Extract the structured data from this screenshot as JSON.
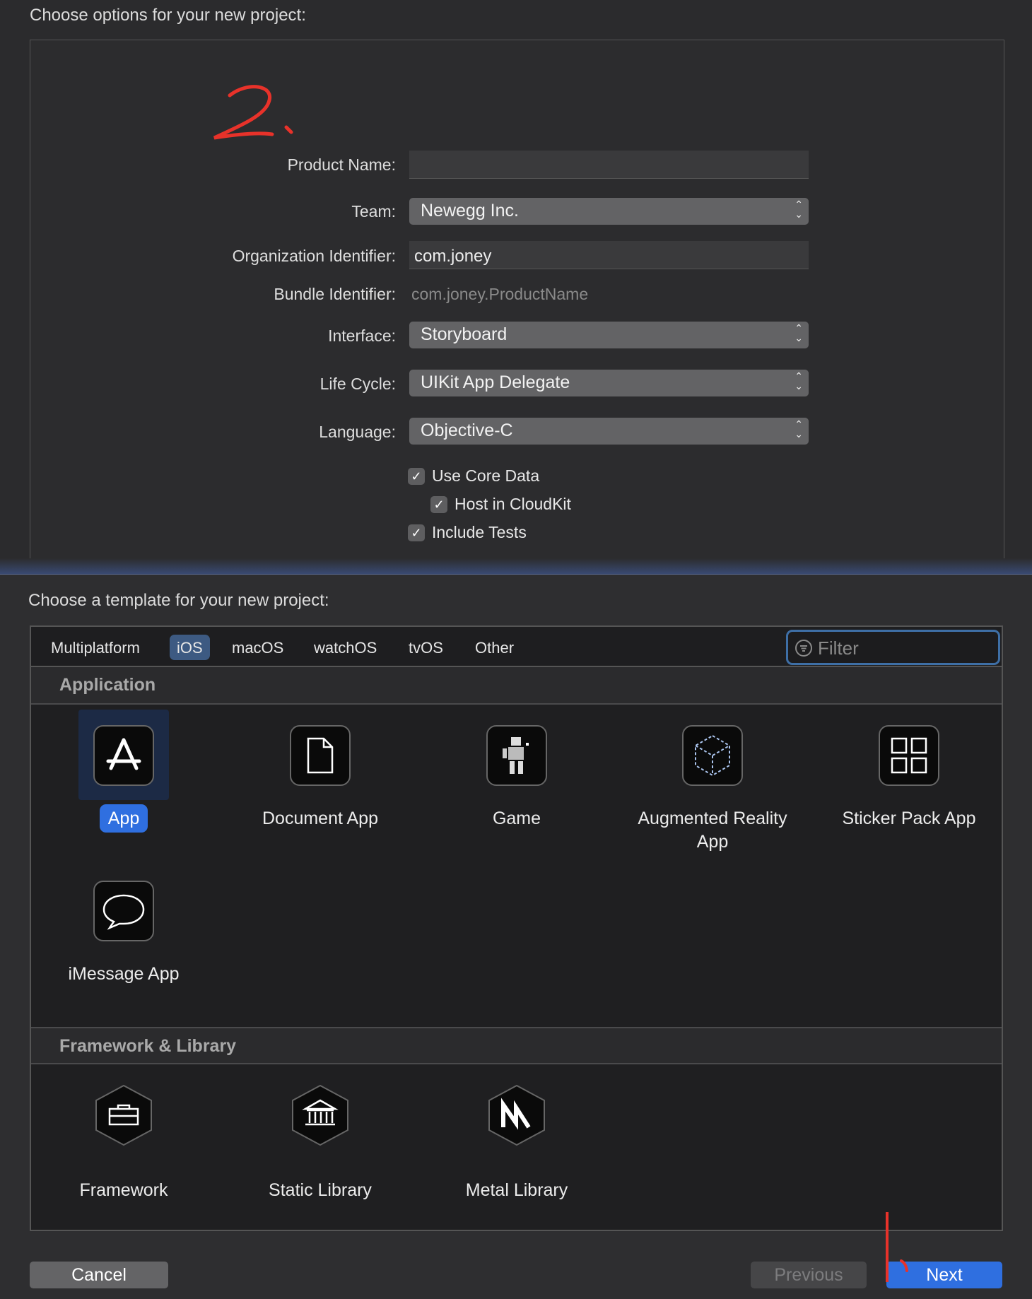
{
  "options": {
    "heading": "Choose options for your new project:",
    "annotation": "2.",
    "product_name_label": "Product Name:",
    "product_name_value": "",
    "team_label": "Team:",
    "team_value": "Newegg Inc.",
    "org_label": "Organization Identifier:",
    "org_value": "com.joney",
    "bundle_label": "Bundle Identifier:",
    "bundle_value": "com.joney.ProductName",
    "interface_label": "Interface:",
    "interface_value": "Storyboard",
    "lifecycle_label": "Life Cycle:",
    "lifecycle_value": "UIKit App Delegate",
    "language_label": "Language:",
    "language_value": "Objective-C",
    "checkboxes": [
      {
        "label": "Use Core Data",
        "checked": true
      },
      {
        "label": "Host in CloudKit",
        "checked": true
      },
      {
        "label": "Include Tests",
        "checked": true
      }
    ]
  },
  "template": {
    "heading": "Choose a template for your new project:",
    "tabs": [
      "Multiplatform",
      "iOS",
      "macOS",
      "watchOS",
      "tvOS",
      "Other"
    ],
    "selected_tab": "iOS",
    "filter_placeholder": "Filter",
    "sections": [
      {
        "title": "Application",
        "items": [
          "App",
          "Document App",
          "Game",
          "Augmented Reality App",
          "Sticker Pack App",
          "iMessage App"
        ],
        "selected": "App"
      },
      {
        "title": "Framework & Library",
        "items": [
          "Framework",
          "Static Library",
          "Metal Library"
        ]
      }
    ]
  },
  "buttons": {
    "cancel": "Cancel",
    "previous": "Previous",
    "next": "Next"
  },
  "colors": {
    "accent": "#2f6fe0",
    "annotation": "#e8322a"
  }
}
